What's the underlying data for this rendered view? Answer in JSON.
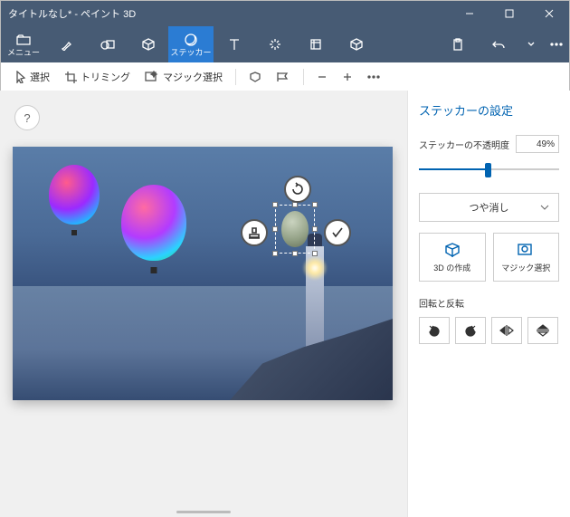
{
  "window": {
    "title": "タイトルなし* - ペイント 3D"
  },
  "ribbon": {
    "menu": "メニュー",
    "stickers": "ステッカー"
  },
  "toolbar": {
    "select": "選択",
    "trimming": "トリミング",
    "magic_select": "マジック選択"
  },
  "sidebar": {
    "title": "ステッカーの設定",
    "opacity_label": "ステッカーの不透明度",
    "opacity_value": "49%",
    "opacity_pct": 49,
    "finish": "つや消し",
    "make3d": "3D の作成",
    "magic": "マジック選択",
    "rotate_flip": "回転と反転"
  },
  "help": "?"
}
